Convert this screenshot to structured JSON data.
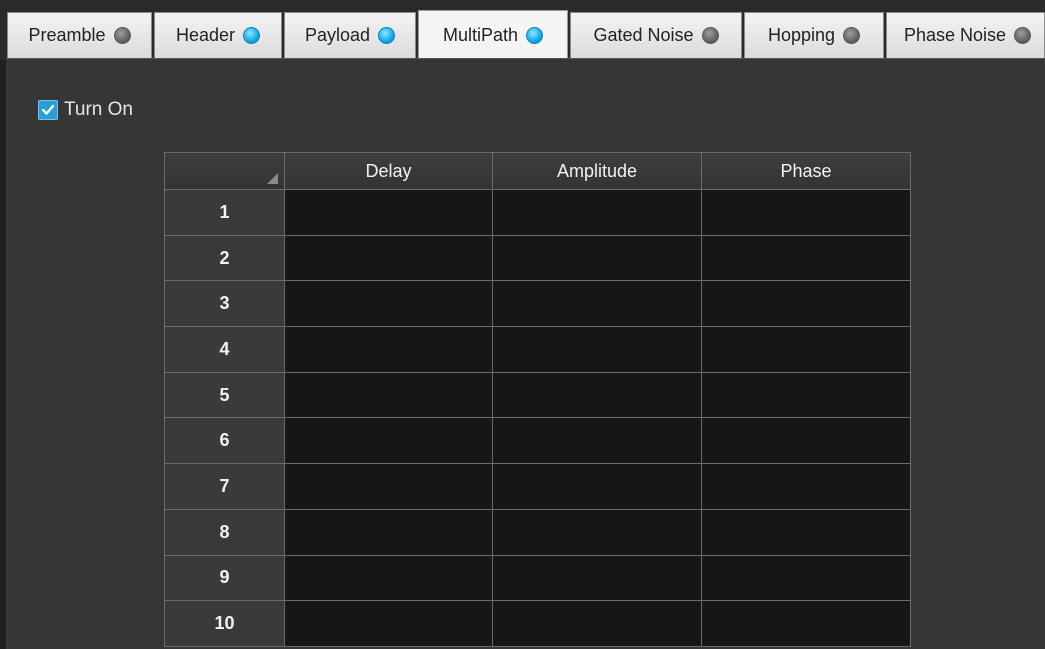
{
  "tabs": [
    {
      "label": "Preamble",
      "status": "inactive"
    },
    {
      "label": "Header",
      "status": "active"
    },
    {
      "label": "Payload",
      "status": "active"
    },
    {
      "label": "MultiPath",
      "status": "active"
    },
    {
      "label": "Gated Noise",
      "status": "inactive"
    },
    {
      "label": "Hopping",
      "status": "inactive"
    },
    {
      "label": "Phase Noise",
      "status": "inactive"
    }
  ],
  "selected_tab": "MultiPath",
  "colors": {
    "led_active": "#10a8e6",
    "led_inactive": "#6b6b6b",
    "checkbox": "#2a9fd6"
  },
  "turn_on": {
    "label": "Turn On",
    "checked": true
  },
  "grid": {
    "columns": [
      "Delay",
      "Amplitude",
      "Phase"
    ],
    "rows": [
      {
        "label": "1",
        "cells": [
          "",
          "",
          ""
        ]
      },
      {
        "label": "2",
        "cells": [
          "",
          "",
          ""
        ]
      },
      {
        "label": "3",
        "cells": [
          "",
          "",
          ""
        ]
      },
      {
        "label": "4",
        "cells": [
          "",
          "",
          ""
        ]
      },
      {
        "label": "5",
        "cells": [
          "",
          "",
          ""
        ]
      },
      {
        "label": "6",
        "cells": [
          "",
          "",
          ""
        ]
      },
      {
        "label": "7",
        "cells": [
          "",
          "",
          ""
        ]
      },
      {
        "label": "8",
        "cells": [
          "",
          "",
          ""
        ]
      },
      {
        "label": "9",
        "cells": [
          "",
          "",
          ""
        ]
      },
      {
        "label": "10",
        "cells": [
          "",
          "",
          ""
        ]
      }
    ]
  }
}
